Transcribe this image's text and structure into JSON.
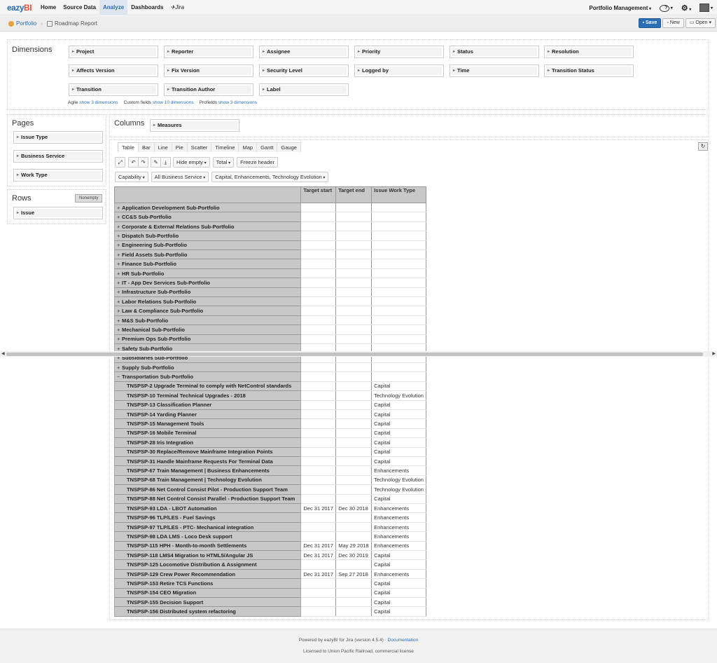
{
  "nav": {
    "logo_a": "eazy",
    "logo_b": "BI",
    "items": [
      "Home",
      "Source Data",
      "Analyze",
      "Dashboards",
      "Jira"
    ],
    "active": "Analyze",
    "portfolio_menu": "Portfolio Management",
    "help_icon": "?",
    "settings_icon": "gear-icon",
    "user_icon": "avatar"
  },
  "subbar": {
    "crumb": "Portfolio",
    "report": "Roadmap Report",
    "save": "Save",
    "new": "New",
    "open": "Open"
  },
  "dimensions": {
    "title": "Dimensions",
    "chips": [
      "Project",
      "Reporter",
      "Assignee",
      "Priority",
      "Status",
      "Resolution",
      "Affects Version",
      "Fix Version",
      "Security Level",
      "Logged by",
      "Time",
      "Transition Status",
      "Transition",
      "Transition Author",
      "Label"
    ],
    "agile_label": "Agile",
    "agile_link": "show 3 dimensions",
    "custom_label": "Custom fields",
    "custom_link": "show 10 dimensions",
    "profields_label": "Profields",
    "profields_link": "show 3 dimensions"
  },
  "pages": {
    "title": "Pages",
    "items": [
      "Issue Type",
      "Business Service",
      "Work Type"
    ]
  },
  "rows": {
    "title": "Rows",
    "nonempty": "Nonempty",
    "items": [
      "Issue"
    ]
  },
  "columns": {
    "title": "Columns",
    "items": [
      "Measures"
    ]
  },
  "tabs": [
    "Table",
    "Bar",
    "Line",
    "Pie",
    "Scatter",
    "Timeline",
    "Map",
    "Gantt",
    "Gauge"
  ],
  "active_tab": "Table",
  "toolbar": {
    "hide_empty": "Hide empty",
    "total": "Total",
    "freeze_header": "Freeze header",
    "filter1": "Capability",
    "filter2": "All Business Service",
    "filter3": "Capital, Enhancements, Technology Evolution"
  },
  "grid": {
    "headers": [
      " ",
      "Target start",
      "Target end",
      "Issue Work Type"
    ],
    "rows": [
      {
        "label": "Application Development Sub-Portfolio",
        "exp": "+",
        "start": "",
        "end": "",
        "type": ""
      },
      {
        "label": "CC&S Sub-Portfolio",
        "exp": "+",
        "start": "",
        "end": "",
        "type": ""
      },
      {
        "label": "Corporate & External Relations Sub-Portfolio",
        "exp": "+",
        "start": "",
        "end": "",
        "type": ""
      },
      {
        "label": "Dispatch Sub-Portfolio",
        "exp": "+",
        "start": "",
        "end": "",
        "type": ""
      },
      {
        "label": "Engineering Sub-Portfolio",
        "exp": "+",
        "start": "",
        "end": "",
        "type": ""
      },
      {
        "label": "Field Assets Sub-Portfolio",
        "exp": "+",
        "start": "",
        "end": "",
        "type": ""
      },
      {
        "label": "Finance Sub-Portfolio",
        "exp": "+",
        "start": "",
        "end": "",
        "type": ""
      },
      {
        "label": "HR Sub-Portfolio",
        "exp": "+",
        "start": "",
        "end": "",
        "type": ""
      },
      {
        "label": "IT - App Dev Services Sub-Portfolio",
        "exp": "+",
        "start": "",
        "end": "",
        "type": ""
      },
      {
        "label": "Infrastructure Sub-Portfolio",
        "exp": "+",
        "start": "",
        "end": "",
        "type": ""
      },
      {
        "label": "Labor Relations Sub-Portfolio",
        "exp": "+",
        "start": "",
        "end": "",
        "type": ""
      },
      {
        "label": "Law & Compliance Sub-Portfolio",
        "exp": "+",
        "start": "",
        "end": "",
        "type": ""
      },
      {
        "label": "M&S Sub-Portfolio",
        "exp": "+",
        "start": "",
        "end": "",
        "type": ""
      },
      {
        "label": "Mechanical Sub-Portfolio",
        "exp": "+",
        "start": "",
        "end": "",
        "type": ""
      },
      {
        "label": "Premium Ops Sub-Portfolio",
        "exp": "+",
        "start": "",
        "end": "",
        "type": ""
      },
      {
        "label": "Safety Sub-Portfolio",
        "exp": "+",
        "start": "",
        "end": "",
        "type": ""
      },
      {
        "label": "Subsidiaries Sub-Portfolio",
        "exp": "+",
        "start": "",
        "end": "",
        "type": ""
      },
      {
        "label": "Supply Sub-Portfolio",
        "exp": "+",
        "start": "",
        "end": "",
        "type": ""
      },
      {
        "label": "Transportation Sub-Portfolio",
        "exp": "−",
        "start": "",
        "end": "",
        "type": ""
      },
      {
        "label": "TNSPSP-2 Upgrade Terminal to comply with NetControl standards",
        "child": true,
        "start": "",
        "end": "",
        "type": "Capital"
      },
      {
        "label": "TNSPSP-10 Terminal Technical Upgrades - 2018",
        "child": true,
        "start": "",
        "end": "",
        "type": "Technology Evolution"
      },
      {
        "label": "TNSPSP-13 Classification Planner",
        "child": true,
        "start": "",
        "end": "",
        "type": "Capital"
      },
      {
        "label": "TNSPSP-14 Yarding Planner",
        "child": true,
        "start": "",
        "end": "",
        "type": "Capital"
      },
      {
        "label": "TNSPSP-15 Management Tools",
        "child": true,
        "start": "",
        "end": "",
        "type": "Capital"
      },
      {
        "label": "TNSPSP-16 Mobile Terminal",
        "child": true,
        "start": "",
        "end": "",
        "type": "Capital"
      },
      {
        "label": "TNSPSP-28 Iris Integration",
        "child": true,
        "start": "",
        "end": "",
        "type": "Capital"
      },
      {
        "label": "TNSPSP-30 Replace/Remove Mainframe Integration Points",
        "child": true,
        "start": "",
        "end": "",
        "type": "Capital"
      },
      {
        "label": "TNSPSP-31 Handle Mainframe Requests For Terminal Data",
        "child": true,
        "start": "",
        "end": "",
        "type": "Capital"
      },
      {
        "label": "TNSPSP-67 Train Management | Business Enhancements",
        "child": true,
        "start": "",
        "end": "",
        "type": "Enhancements"
      },
      {
        "label": "TNSPSP-68 Train Management | Technology Evolution",
        "child": true,
        "start": "",
        "end": "",
        "type": "Technology Evolution"
      },
      {
        "label": "TNSPSP-86 Net Control Consist Pilot - Production Support Team",
        "child": true,
        "start": "",
        "end": "",
        "type": "Technology Evolution"
      },
      {
        "label": "TNSPSP-88 Net Control Consist Parallel - Production Support Team",
        "child": true,
        "start": "",
        "end": "",
        "type": "Capital"
      },
      {
        "label": "TNSPSP-93 LDA - LBOT Automation",
        "child": true,
        "start": "Dec 31 2017",
        "end": "Dec 30 2018",
        "type": "Enhancements"
      },
      {
        "label": "TNSPSP-96 TLP/LES - Fuel Savings",
        "child": true,
        "start": "",
        "end": "",
        "type": "Enhancements"
      },
      {
        "label": "TNSPSP-97 TLP/LES - PTC- Mechanical integration",
        "child": true,
        "start": "",
        "end": "",
        "type": "Enhancements"
      },
      {
        "label": "TNSPSP-98 LDA LMS - Loco Desk support",
        "child": true,
        "start": "",
        "end": "",
        "type": "Enhancements"
      },
      {
        "label": "TNSPSP-115 HPH - Month-to-month Settlements",
        "child": true,
        "start": "Dec 31 2017",
        "end": "May 29 2018",
        "type": "Enhancements"
      },
      {
        "label": "TNSPSP-118 LMS4 Migration to HTML5/Angular JS",
        "child": true,
        "start": "Dec 31 2017",
        "end": "Dec 30 2019",
        "type": "Capital"
      },
      {
        "label": "TNSPSP-125 Locomotive Distribution & Assignment",
        "child": true,
        "start": "",
        "end": "",
        "type": "Capital"
      },
      {
        "label": "TNSPSP-129 Crew Power Recommendation",
        "child": true,
        "start": "Dec 31 2017",
        "end": "Sep 27 2018",
        "type": "Enhancements"
      },
      {
        "label": "TNSPSP-153 Retire TCS Functions",
        "child": true,
        "start": "",
        "end": "",
        "type": "Capital"
      },
      {
        "label": "TNSPSP-154 CEO Migration",
        "child": true,
        "start": "",
        "end": "",
        "type": "Capital"
      },
      {
        "label": "TNSPSP-155 Decision Support",
        "child": true,
        "start": "",
        "end": "",
        "type": "Capital"
      },
      {
        "label": "TNSPSP-156 Distributed system refactoring",
        "child": true,
        "start": "",
        "end": "",
        "type": "Capital"
      }
    ]
  },
  "footer": {
    "powered": "Powered by eazyBI for Jira (version 4.5.4)",
    "doc": "Documentation",
    "license": "Licensed to Union Pacific Railroad, commercial license"
  }
}
